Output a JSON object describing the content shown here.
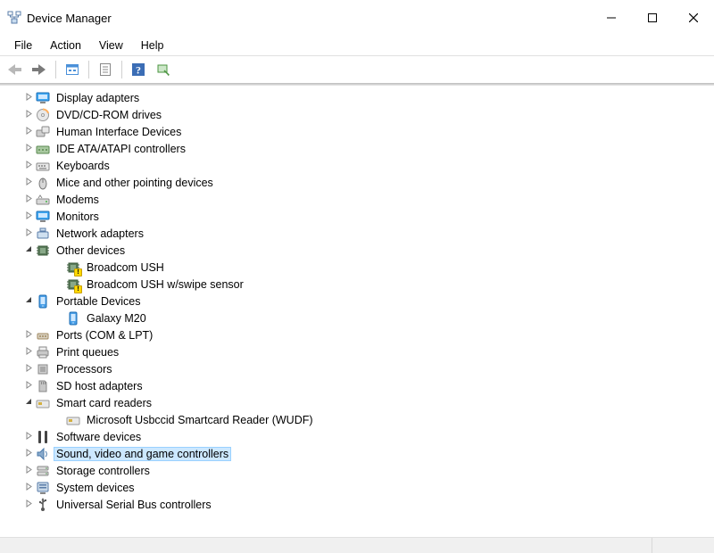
{
  "window": {
    "title": "Device Manager"
  },
  "menu": {
    "items": [
      "File",
      "Action",
      "View",
      "Help"
    ]
  },
  "toolbar": {
    "buttons": [
      "back",
      "forward",
      "show-hidden",
      "properties",
      "help",
      "scan-hardware"
    ]
  },
  "tree": [
    {
      "id": "display",
      "label": "Display adapters",
      "expanded": false,
      "icon": "monitor-blue"
    },
    {
      "id": "dvdcd",
      "label": "DVD/CD-ROM drives",
      "expanded": false,
      "icon": "disc"
    },
    {
      "id": "hid",
      "label": "Human Interface Devices",
      "expanded": false,
      "icon": "hid"
    },
    {
      "id": "ide",
      "label": "IDE ATA/ATAPI controllers",
      "expanded": false,
      "icon": "ata"
    },
    {
      "id": "keyboards",
      "label": "Keyboards",
      "expanded": false,
      "icon": "keyboard"
    },
    {
      "id": "mice",
      "label": "Mice and other pointing devices",
      "expanded": false,
      "icon": "mouse"
    },
    {
      "id": "modems",
      "label": "Modems",
      "expanded": false,
      "icon": "modem"
    },
    {
      "id": "monitors",
      "label": "Monitors",
      "expanded": false,
      "icon": "monitor"
    },
    {
      "id": "network",
      "label": "Network adapters",
      "expanded": false,
      "icon": "network"
    },
    {
      "id": "other",
      "label": "Other devices",
      "expanded": true,
      "icon": "chip",
      "children": [
        {
          "id": "bush",
          "label": "Broadcom USH",
          "icon": "chip",
          "warn": true
        },
        {
          "id": "bushsw",
          "label": "Broadcom USH w/swipe sensor",
          "icon": "chip",
          "warn": true
        }
      ]
    },
    {
      "id": "portable",
      "label": "Portable Devices",
      "expanded": true,
      "icon": "phone",
      "children": [
        {
          "id": "galaxy",
          "label": "Galaxy M20",
          "icon": "phone-small"
        }
      ]
    },
    {
      "id": "ports",
      "label": "Ports (COM & LPT)",
      "expanded": false,
      "icon": "port"
    },
    {
      "id": "printq",
      "label": "Print queues",
      "expanded": false,
      "icon": "printer"
    },
    {
      "id": "proc",
      "label": "Processors",
      "expanded": false,
      "icon": "cpu"
    },
    {
      "id": "sdhost",
      "label": "SD host adapters",
      "expanded": false,
      "icon": "sd"
    },
    {
      "id": "smartcard",
      "label": "Smart card readers",
      "expanded": true,
      "icon": "card",
      "children": [
        {
          "id": "wudf",
          "label": "Microsoft Usbccid Smartcard Reader (WUDF)",
          "icon": "card"
        }
      ]
    },
    {
      "id": "softdev",
      "label": "Software devices",
      "expanded": false,
      "icon": "softdev"
    },
    {
      "id": "sound",
      "label": "Sound, video and game controllers",
      "expanded": false,
      "icon": "sound",
      "selected": true
    },
    {
      "id": "storage",
      "label": "Storage controllers",
      "expanded": false,
      "icon": "storage"
    },
    {
      "id": "system",
      "label": "System devices",
      "expanded": false,
      "icon": "system"
    },
    {
      "id": "usb",
      "label": "Universal Serial Bus controllers",
      "expanded": false,
      "icon": "usb"
    }
  ]
}
